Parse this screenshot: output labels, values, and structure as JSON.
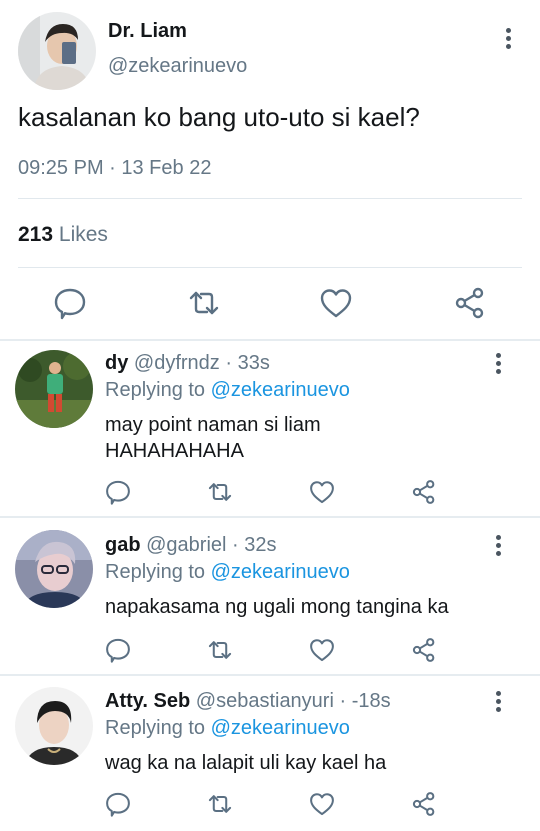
{
  "main_tweet": {
    "name": "Dr. Liam",
    "handle": "@zekearinuevo",
    "text": "kasalanan ko bang uto-uto si kael?",
    "timestamp": "09:25 PM · 13 Feb 22",
    "likes_count": "213",
    "likes_label": "Likes",
    "actions": [
      "reply-icon",
      "retweet-icon",
      "like-icon",
      "share-icon"
    ]
  },
  "replies": [
    {
      "name": "dy",
      "handle": "@dyfrndz",
      "time": " · 33s",
      "replying_label": "Replying to",
      "replying_to": "@zekearinuevo",
      "text_line1": "may point naman si liam",
      "text_line2": "HAHAHAHAHA"
    },
    {
      "name": "gab",
      "handle": "@gabriel",
      "time": " · 32s",
      "replying_label": "Replying to",
      "replying_to": "@zekearinuevo",
      "text_line1": "napakasama ng ugali mong tangina ka",
      "text_line2": ""
    },
    {
      "name": "Atty. Seb",
      "handle": "@sebastianyuri",
      "time": " · -18s",
      "replying_label": "Replying to",
      "replying_to": "@zekearinuevo",
      "text_line1": "wag ka na lalapit uli kay kael ha",
      "text_line2": ""
    }
  ],
  "colors": {
    "text": "#14171a",
    "secondary": "#657786",
    "link": "#1b95e0",
    "icon": "#5b7083",
    "divider": "#e1e8ed"
  }
}
